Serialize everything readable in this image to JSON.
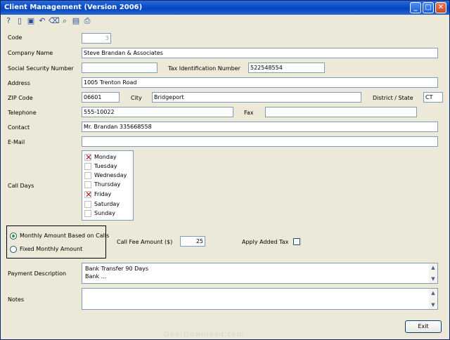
{
  "window": {
    "title": "Client Management (Version 2006)",
    "buttons": {
      "minimize": "_",
      "maximize": "□",
      "close": "✕"
    }
  },
  "toolbar": {
    "icons": [
      "help-icon",
      "new-icon",
      "save-icon",
      "undo-icon",
      "delete-icon",
      "search-icon",
      "print-preview-icon",
      "print-icon"
    ]
  },
  "form": {
    "code": {
      "label": "Code",
      "value": "3"
    },
    "company_name": {
      "label": "Company Name",
      "value": "Steve Brandan & Associates"
    },
    "ssn": {
      "label": "Social Security Number",
      "value": ""
    },
    "tax_id": {
      "label": "Tax Identification Number",
      "value": "522548554"
    },
    "address": {
      "label": "Address",
      "value": "1005 Trenton Road"
    },
    "zip": {
      "label": "ZIP Code",
      "value": "06601"
    },
    "city": {
      "label": "City",
      "value": "Bridgeport"
    },
    "district": {
      "label": "District / State",
      "value": "CT"
    },
    "telephone": {
      "label": "Telephone",
      "value": "555-10022"
    },
    "fax": {
      "label": "Fax",
      "value": ""
    },
    "contact": {
      "label": "Contact",
      "value": "Mr. Brandan 335668558"
    },
    "email": {
      "label": "E-Mail",
      "value": ""
    },
    "call_days": {
      "label": "Call Days",
      "days": [
        {
          "name": "Monday",
          "checked": true
        },
        {
          "name": "Tuesday",
          "checked": false
        },
        {
          "name": "Wednesday",
          "checked": false
        },
        {
          "name": "Thursday",
          "checked": false
        },
        {
          "name": "Friday",
          "checked": true
        },
        {
          "name": "Saturday",
          "checked": false
        },
        {
          "name": "Sunday",
          "checked": false
        }
      ]
    },
    "billing": {
      "option_calls": "Monthly Amount Based on Calls",
      "option_fixed": "Fixed Monthly Amount",
      "selected": "calls"
    },
    "call_fee": {
      "label": "Call Fee Amount ($)",
      "value": "25"
    },
    "apply_tax": {
      "label": "Apply Added Tax",
      "checked": false
    },
    "payment_description": {
      "label": "Payment Description",
      "line1": "Bank Transfer 90 Days",
      "line2": "Bank ..."
    },
    "notes": {
      "label": "Notes",
      "value": ""
    }
  },
  "exit_label": "Exit",
  "watermark": "GearDownload.com"
}
